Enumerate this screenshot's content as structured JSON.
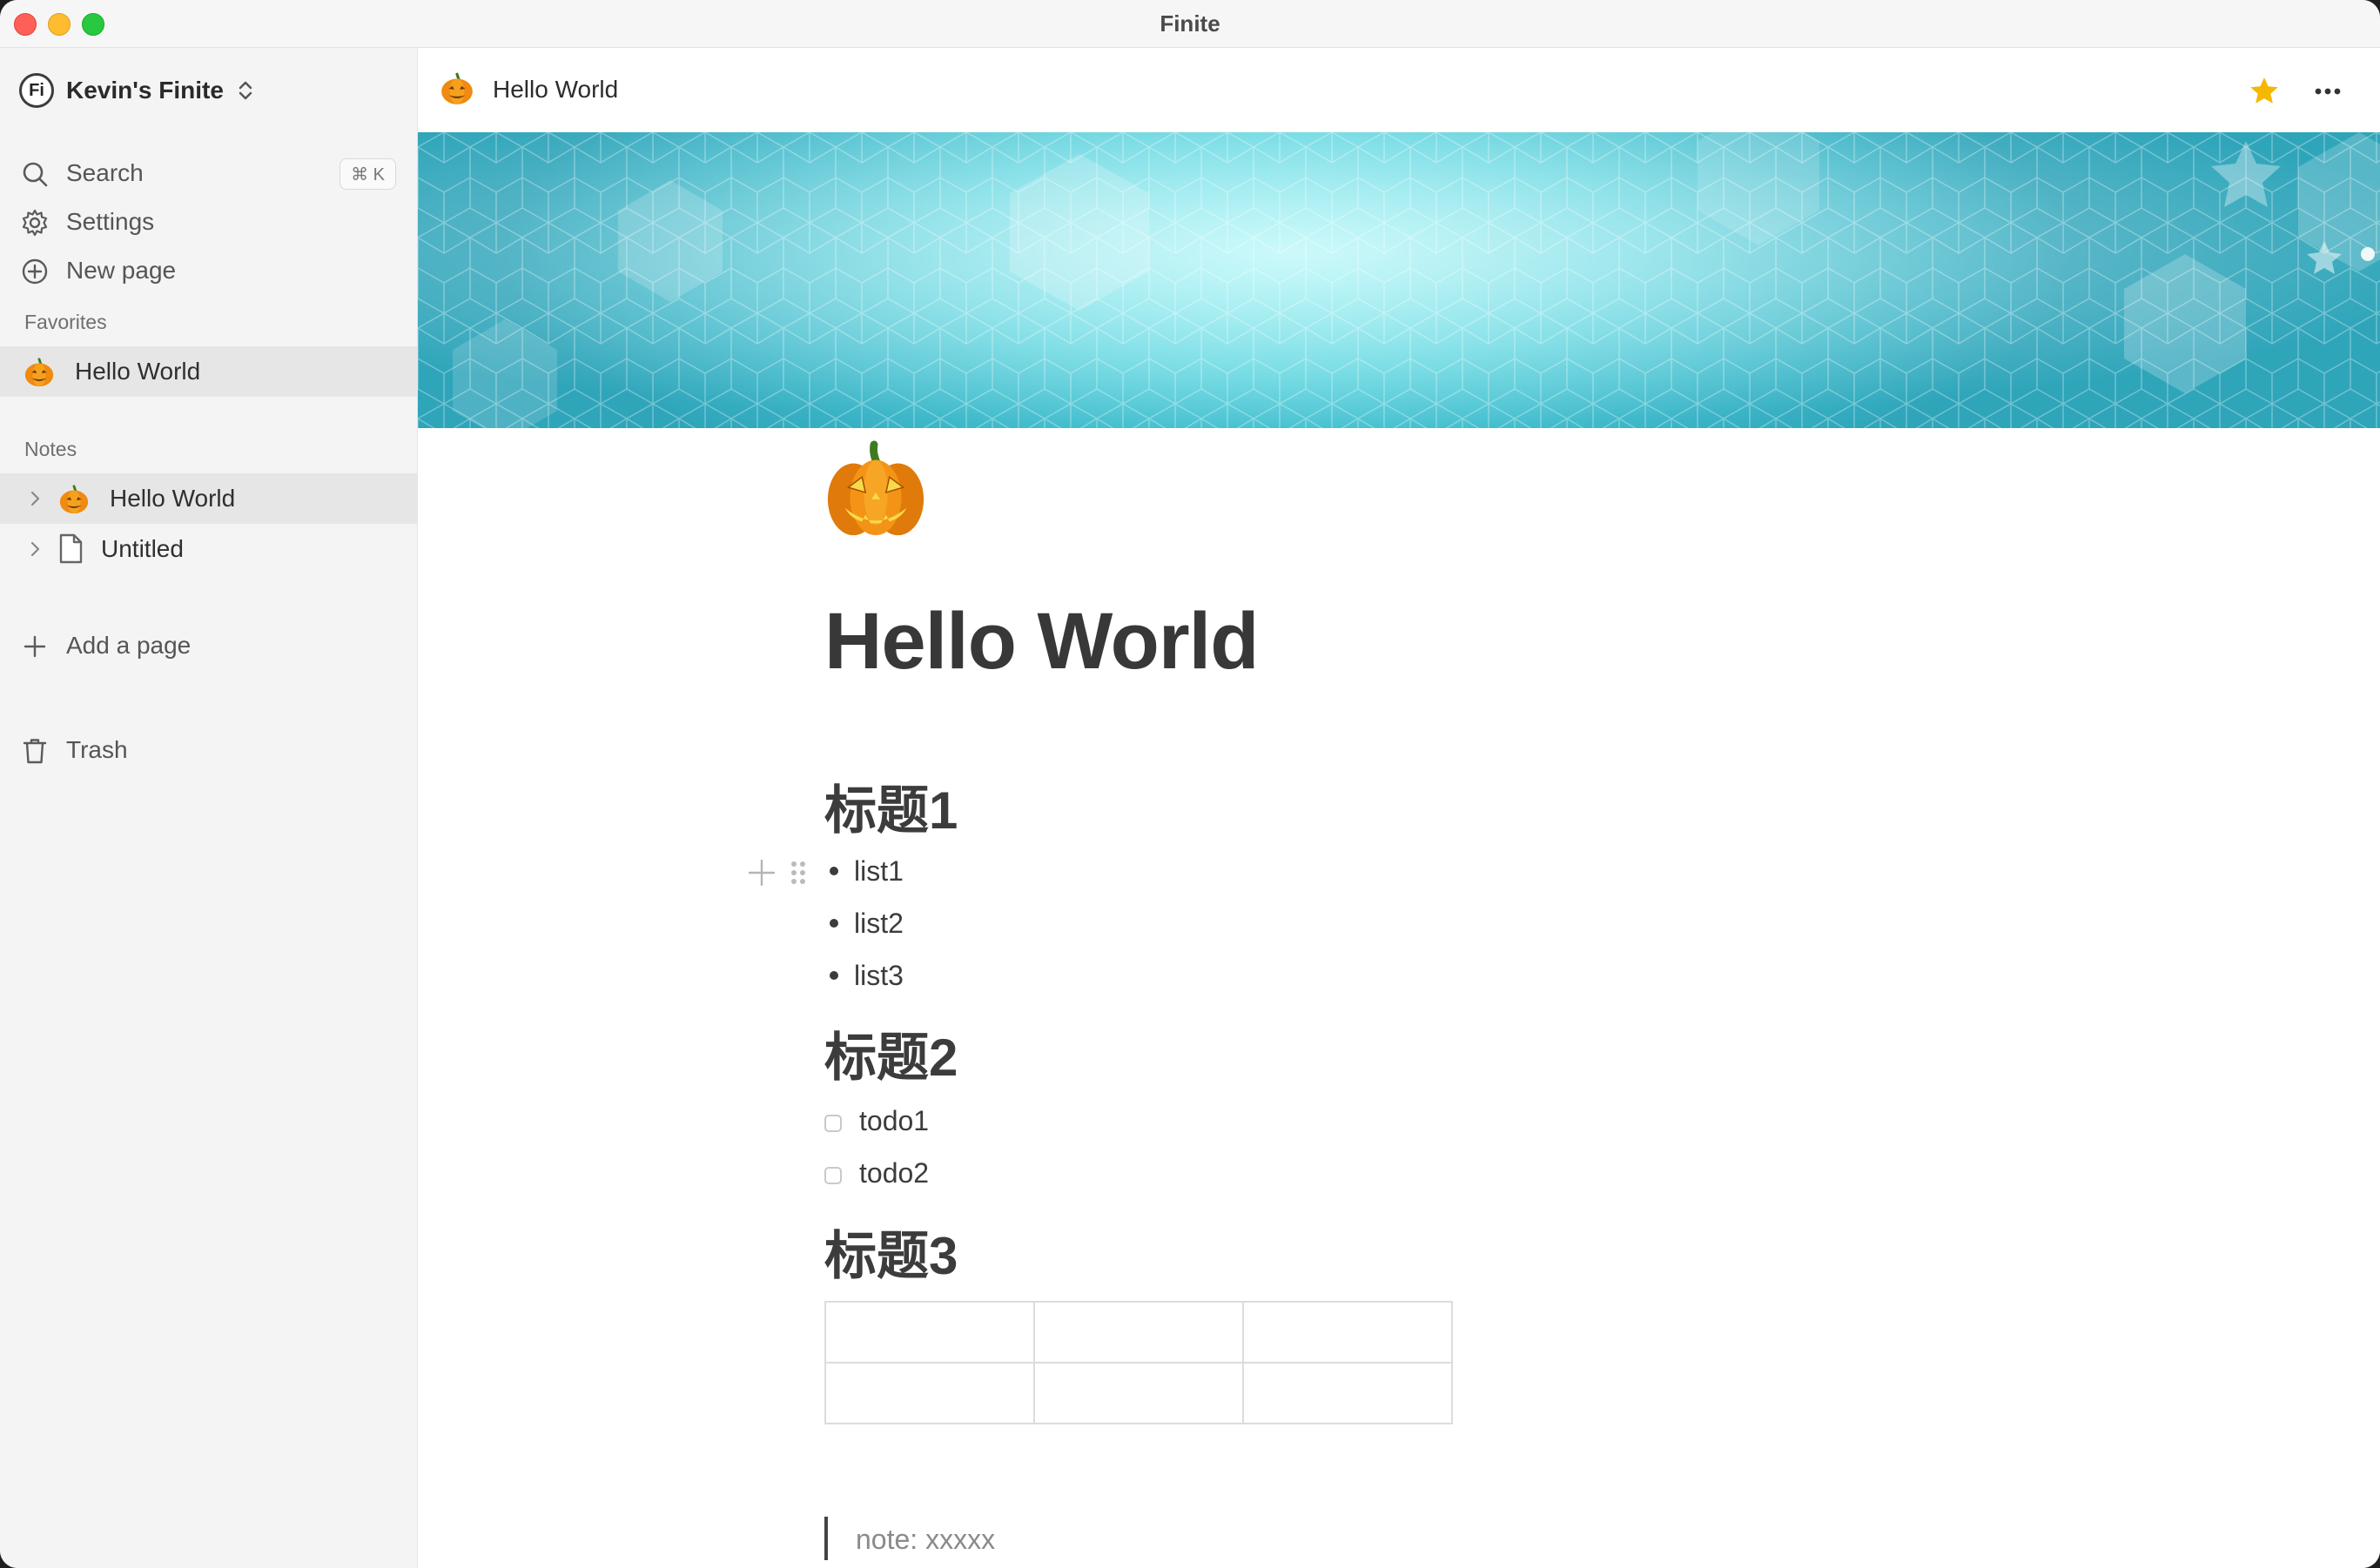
{
  "window": {
    "title": "Finite"
  },
  "sidebar": {
    "workspace_logo": "Fi",
    "workspace_name": "Kevin's Finite",
    "menu": [
      {
        "label": "Search",
        "icon": "search-icon",
        "shortcut": "⌘ K"
      },
      {
        "label": "Settings",
        "icon": "gear-icon"
      },
      {
        "label": "New page",
        "icon": "plus-circle-icon"
      }
    ],
    "favorites": {
      "heading": "Favorites",
      "items": [
        {
          "label": "Hello World",
          "icon": "pumpkin-icon"
        }
      ]
    },
    "notes": {
      "heading": "Notes",
      "items": [
        {
          "label": "Hello World",
          "icon": "pumpkin-icon"
        },
        {
          "label": "Untitled",
          "icon": "document-icon"
        }
      ],
      "add_label": "Add a page"
    },
    "trash_label": "Trash"
  },
  "topbar": {
    "breadcrumb": "Hello World",
    "star_color": "#f5b800"
  },
  "page": {
    "title": "Hello World",
    "heading1": "标题1",
    "bullets": [
      "list1",
      "list2",
      "list3"
    ],
    "heading2": "标题2",
    "todos": [
      {
        "label": "todo1",
        "checked": false
      },
      {
        "label": "todo2",
        "checked": false
      }
    ],
    "heading3": "标题3",
    "table": {
      "rows": 2,
      "cols": 3
    },
    "quote": "note: xxxxx"
  },
  "colors": {
    "banner": "#4cc6d6",
    "sidebar_bg": "#f4f4f4",
    "accent_star": "#f5b800"
  }
}
